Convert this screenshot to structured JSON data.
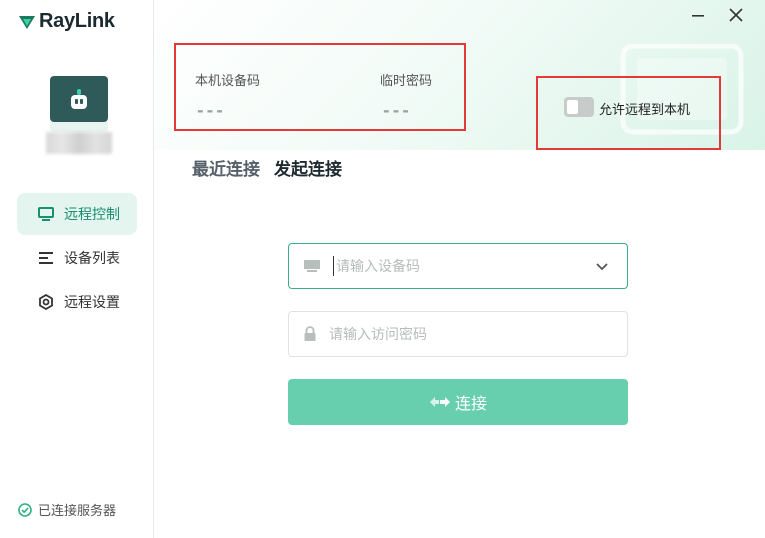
{
  "app": {
    "name": "RayLink"
  },
  "sidebar": {
    "items": [
      {
        "label": "远程控制",
        "icon": "monitor-icon",
        "active": true
      },
      {
        "label": "设备列表",
        "icon": "list-icon",
        "active": false
      },
      {
        "label": "远程设置",
        "icon": "settings-icon",
        "active": false
      }
    ],
    "server_status": "已连接服务器"
  },
  "device_info": {
    "device_code_label": "本机设备码",
    "device_code_value": "---",
    "temp_password_label": "临时密码",
    "temp_password_value": "---"
  },
  "remote_toggle": {
    "label": "允许远程到本机",
    "enabled": false
  },
  "tabs": [
    {
      "label": "最近连接",
      "active": false
    },
    {
      "label": "发起连接",
      "active": true
    }
  ],
  "form": {
    "device_code_placeholder": "请输入设备码",
    "password_placeholder": "请输入访问密码",
    "connect_label": "连接"
  },
  "colors": {
    "accent": "#67cfad",
    "active_nav_bg": "#e3f5ee",
    "annotation": "#e53935"
  }
}
